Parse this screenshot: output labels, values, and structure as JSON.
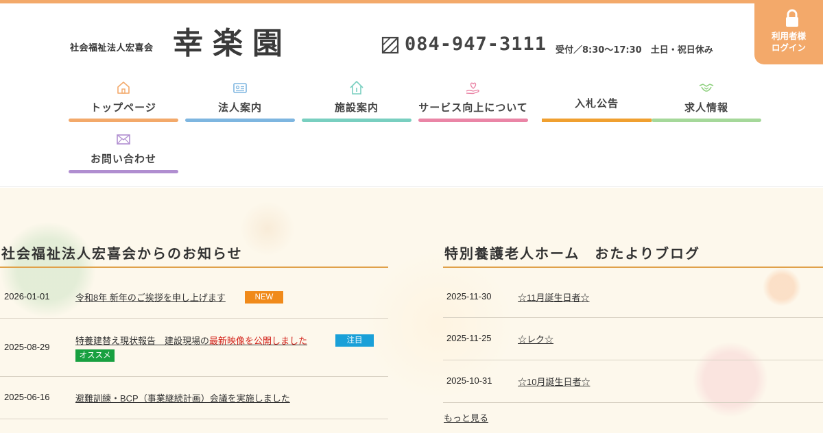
{
  "header": {
    "org_name": "社会福祉法人宏喜会",
    "facility_name": "幸楽園",
    "phone": "084-947-3111",
    "hours": "受付／8:30～17:30　土日・祝日休み",
    "login_label_line1": "利用者様",
    "login_label_line2": "ログイン"
  },
  "nav": {
    "items": [
      {
        "label": "トップページ",
        "icon": "house-icon",
        "color": "#f3a96a"
      },
      {
        "label": "法人案内",
        "icon": "id-card-icon",
        "color": "#7eb6e0"
      },
      {
        "label": "施設案内",
        "icon": "building-icon",
        "color": "#79cfc0"
      },
      {
        "label": "サービス向上について",
        "icon": "heart-hand-icon",
        "color": "#ea85a6"
      },
      {
        "label": "入札公告",
        "icon": "",
        "color": "#f0a030"
      },
      {
        "label": "求人情報",
        "icon": "handshake-icon",
        "color": "#a5d89a"
      },
      {
        "label": "お問い合わせ",
        "icon": "mail-icon",
        "color": "#b08ed0"
      }
    ]
  },
  "news": {
    "title": "社会福祉法人宏喜会からのお知らせ",
    "items": [
      {
        "date": "2026-01-01",
        "title": "令和8年 新年のご挨拶を申し上げます",
        "badge": "NEW"
      },
      {
        "date": "2025-08-29",
        "title_plain": "特養建替え現状報告　建設現場の",
        "title_highlight": "最新映像を公開しました",
        "badge": "注目",
        "badge2": "オススメ"
      },
      {
        "date": "2025-06-16",
        "title": "避難訓練・BCP（事業継続計画）会議を実施しました"
      }
    ]
  },
  "blog": {
    "title": "特別養護老人ホーム　おたよりブログ",
    "items": [
      {
        "date": "2025-11-30",
        "title": "☆11月誕生日者☆"
      },
      {
        "date": "2025-11-25",
        "title": "☆レク☆"
      },
      {
        "date": "2025-10-31",
        "title": "☆10月誕生日者☆"
      }
    ],
    "more": "もっと見る"
  },
  "colors": {
    "accent": "#f3a96a",
    "rule": "#e0a14a",
    "badge_new": "#f08a1a",
    "badge_attention": "#1aa0d8",
    "badge_recommend": "#18a040",
    "highlight": "#d3231b"
  }
}
